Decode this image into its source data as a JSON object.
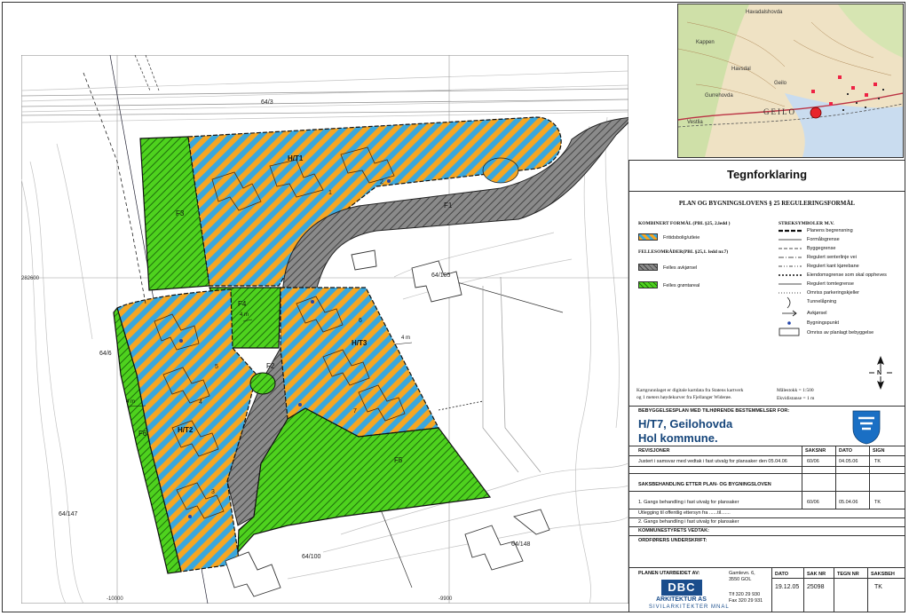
{
  "colors": {
    "orange": "#f5a623",
    "blue": "#3aa7dc",
    "green": "#4ed21e",
    "gray": "#8a8a8a",
    "redmarker": "#e8242a",
    "lines": "#bdbdbd"
  },
  "map": {
    "coords": {
      "n_left": "282600",
      "e_bottom_left": "-10000",
      "e_bottom_mid": "-9900"
    },
    "parcels": {
      "p1": "64/3",
      "p2": "64/6",
      "p3": "64/105",
      "p4": "64/147",
      "p5": "64/100",
      "p6": "64/148"
    },
    "zones": {
      "ht1": "H/T1",
      "ht2": "H/T2",
      "ht3": "H/T3",
      "f1": "F1",
      "f2": "F2",
      "f3": "F3",
      "f4": "F4",
      "f5": "F5",
      "f6": "F6"
    },
    "plots": [
      "1",
      "2",
      "3",
      "4",
      "5",
      "6",
      "7"
    ],
    "dims": {
      "d1": "4 m",
      "d2": "4 m",
      "d3": "4 m"
    }
  },
  "locator": {
    "labels": {
      "a": "Havadalshovda",
      "b": "Geilo",
      "c": "GEILO",
      "d": "Kappen",
      "e": "Gurrehovda",
      "f": "Havsdal",
      "g": "Vestlia"
    }
  },
  "legend": {
    "title": "Tegnforklaring",
    "subtitle": "PLAN OG BYGNINGSLOVENS § 25 REGULERINGSFORMÅL",
    "kombinert_head": "KOMBINERT FORMÅL (PBL §25, 2.ledd )",
    "kombinert_item": "Fritidsbolig/utleie",
    "felles_head": "FELLESOMRÅDER(PBL §25,1. ledd nr.7)",
    "felles_items": [
      "Felles avkjørsel",
      "Felles grøntareal"
    ],
    "strek_head": "STREKSYMBOLER M.V.",
    "strek_items": [
      "Planens begrensning",
      "Formålsgrense",
      "Byggegrense",
      "Regulert senterlinje vei",
      "Regulert kant kjørebane",
      "Eiendomsgrense som skal oppheves",
      "Regulert tomtegrense",
      "Omriss parkeringskjeller",
      "Tunnelåpning",
      "Avkjørsel",
      "Bygningspunkt",
      "Omriss av planlagt bebyggelse"
    ],
    "note1": "Kartgrunnlaget er digitale kartdata fra Statens kartverk",
    "note2": "og 1 meters høydekurver fra Fjellanger Widerøe.",
    "scale": "Målestokk = 1:500",
    "ekv": "Ekvidistanse = 1 m",
    "north": "N",
    "bebyg_head": "BEBYGGELSESPLAN MED TILHØRENDE BESTEMMELSER FOR:",
    "plan_name": "H/T7, Geilohovda",
    "kommune": "Hol kommune.",
    "rev_head": "REVISJONER",
    "col_saksnr": "SAKSNR",
    "col_dato": "DATO",
    "col_sign": "SIGN",
    "rev_row": {
      "text": "Justert i samsvar med vedtak i fast utvalg for plansaker den 05.04.06",
      "saksnr": "60/06",
      "dato": "04.05.06",
      "sign": "TK"
    },
    "saks_head": "SAKSBEHANDLING ETTER PLAN- OG BYGNINGSLOVEN",
    "saks_rows": [
      {
        "text": "1. Gangs behandling i fast utvalg for plansaker",
        "saksnr": "60/06",
        "dato": "05.04.06",
        "sign": "TK"
      },
      {
        "text": "Utlegging til offentlig ettersyn fra ......til.......",
        "saksnr": "",
        "dato": "",
        "sign": ""
      },
      {
        "text": "2. Gangs behandling i fast utvalg for plansaker",
        "saksnr": "",
        "dato": "",
        "sign": ""
      }
    ],
    "kommunestyret": "KOMMUNESTYRETS VEDTAK:",
    "ordforer": "ORDFØRERS UNDERSKRIFT:",
    "utarbeidet": "PLANEN UTARBEIDET AV:",
    "address1": "Gamlevn. 6,",
    "address2": "3550 GOL",
    "tlf": "Tlf 320 29 930",
    "fax": "Fax 320 29 931",
    "logo_letters": "DBC",
    "logo_name": "ARKITEKTUR AS",
    "logo_sub": "SIVILARKITEKTER MNAL",
    "bottom_heads": {
      "dato": "DATO",
      "saknr": "SAK NR",
      "tegnnr": "TEGN NR",
      "saksbeh": "SAKSBEH"
    },
    "bottom_vals": {
      "dato": "19.12.05",
      "saknr": "25098",
      "tegnnr": "",
      "saksbeh": "TK"
    }
  }
}
